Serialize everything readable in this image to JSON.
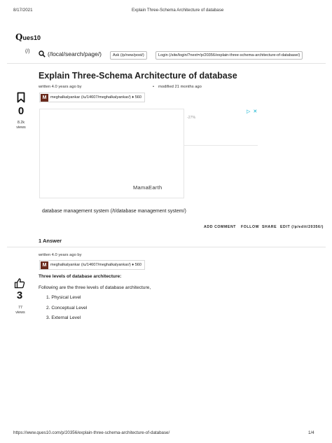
{
  "print": {
    "date": "8/17/2021",
    "doc_title": "Explain Three-Schema Architecture of database",
    "url": "https://www.ques10.com/p/20356/explain-three-schema-architecture-of-database/",
    "page": "1/4"
  },
  "logo": {
    "q": "Q",
    "rest": "ues10",
    "sub": "(/)"
  },
  "nav": {
    "search_link": "(/local/search/page/)",
    "ask_button": "Ask (/p/new/post/)",
    "login_button": "Login (/site/login/?next=/p/20356/explain-three-schema-architecture-of-database/)"
  },
  "question": {
    "title": "Explain Three-Schema Architecture of database",
    "written": "written 4.0 years ago by",
    "modified": "modified 21 months ago",
    "bullet": "•",
    "author_initial": "M",
    "author": "meghalkalyankar (/u/14607/meghalkalyankar/) ♦ 560",
    "votes": "0",
    "views_count": "8.2k",
    "views_label": "views",
    "tag": "database management system (/t/database management system/)",
    "actions": {
      "add_comment": "ADD COMMENT",
      "follow": "FOLLOW",
      "share": "SHARE",
      "edit": "EDIT (/p/edit/20356/)"
    }
  },
  "ad": {
    "percent": "-27%",
    "brand": "MamaEarth",
    "info": "▷",
    "close": "✕"
  },
  "answers_header": "1 Answer",
  "answer": {
    "written": "written 4.0 years ago by",
    "author_initial": "M",
    "author": "meghalkalyankar (/u/14607/meghalkalyankar/) ♦ 560",
    "votes": "3",
    "views_count": "77",
    "views_label": "views",
    "heading": "Three levels of database architecture:",
    "intro": "Following are the three levels of database architecture,",
    "levels": [
      "1. Physical Level",
      "2. Conceptual Level",
      "3. External Level"
    ]
  },
  "icons": {
    "search": "search-icon",
    "bookmark": "bookmark-icon",
    "thumbs_up": "thumbs-up-icon"
  },
  "colors": {
    "avatar": "#6a2a1c",
    "ad_info": "#00aecd"
  }
}
